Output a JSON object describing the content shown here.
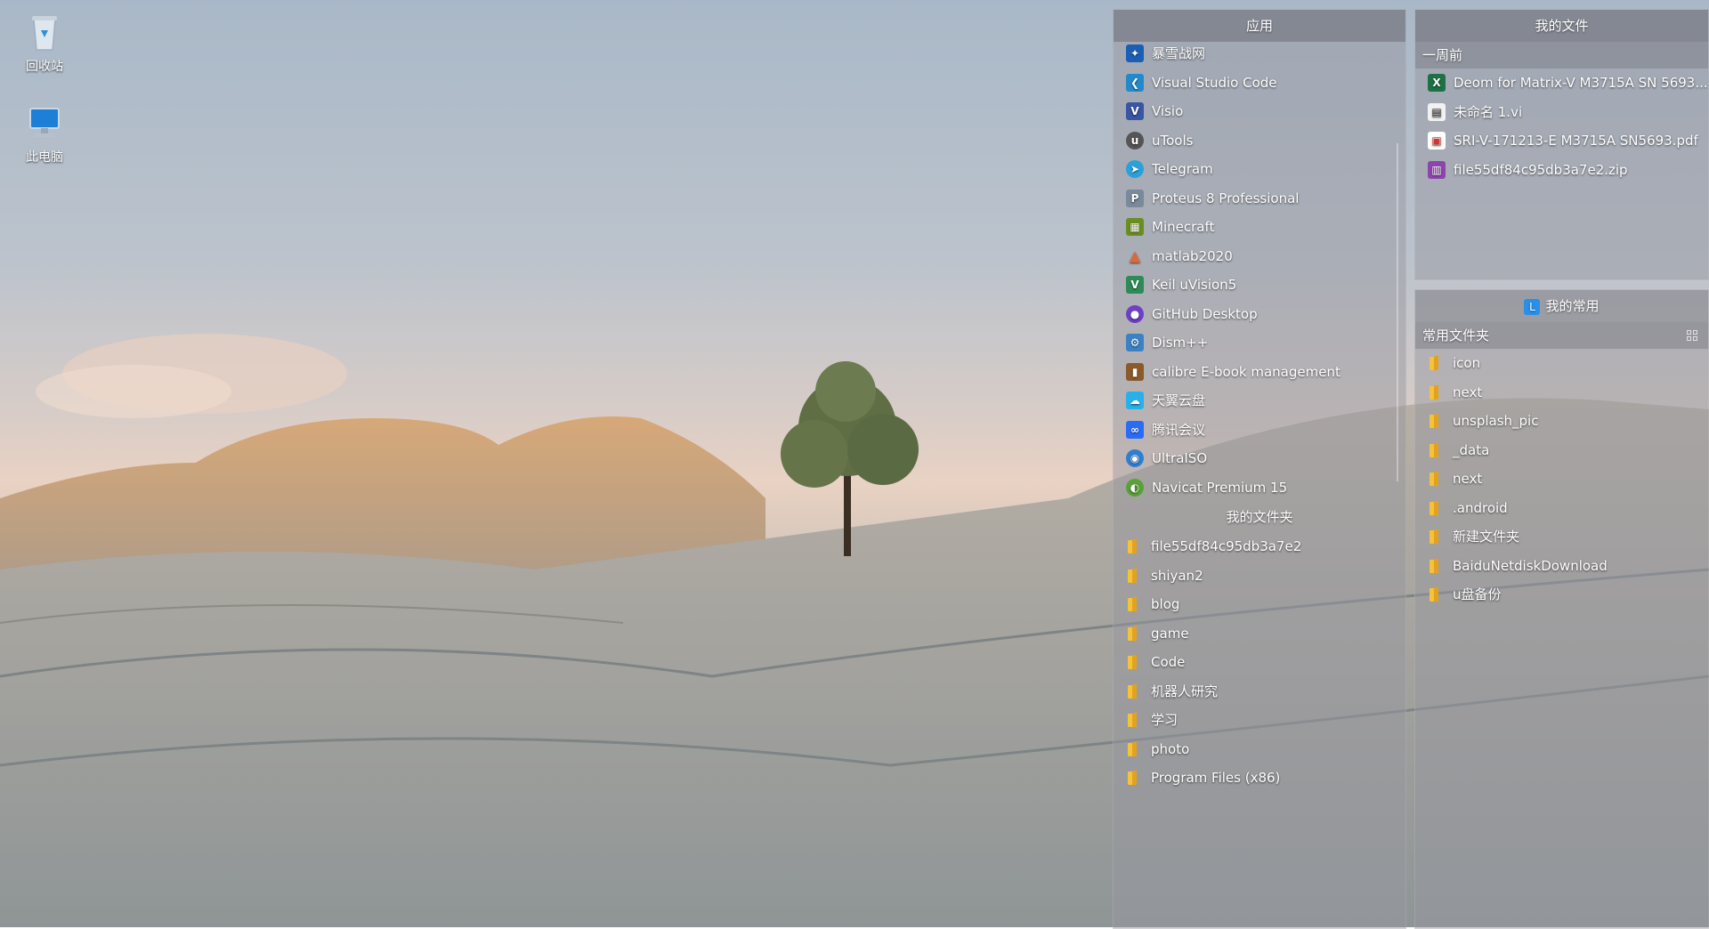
{
  "desktop": {
    "icons": [
      {
        "label": "回收站",
        "icon": "recycle-bin-icon"
      },
      {
        "label": "此电脑",
        "icon": "this-pc-icon"
      }
    ]
  },
  "apps_panel": {
    "title": "应用",
    "apps": [
      {
        "label": "暴雪战网",
        "icon": "battlenet-icon",
        "color": "#1a5fb4"
      },
      {
        "label": "Visual Studio Code",
        "icon": "vscode-icon",
        "color": "#2489ca"
      },
      {
        "label": "Visio",
        "icon": "visio-icon",
        "color": "#3955a3"
      },
      {
        "label": "uTools",
        "icon": "utools-icon",
        "color": "#555555"
      },
      {
        "label": "Telegram",
        "icon": "telegram-icon",
        "color": "#2aa1da"
      },
      {
        "label": "Proteus 8 Professional",
        "icon": "proteus-icon",
        "color": "#7a8a9a"
      },
      {
        "label": "Minecraft",
        "icon": "minecraft-icon",
        "color": "#6b8e23"
      },
      {
        "label": "matlab2020",
        "icon": "matlab-icon",
        "color": "#e16737"
      },
      {
        "label": "Keil uVision5",
        "icon": "keil-icon",
        "color": "#2e8b57"
      },
      {
        "label": "GitHub Desktop",
        "icon": "github-desktop-icon",
        "color": "#6e40c9"
      },
      {
        "label": "Dism++",
        "icon": "dism-icon",
        "color": "#3b82c4"
      },
      {
        "label": "calibre E-book management",
        "icon": "calibre-icon",
        "color": "#8b5a2b"
      },
      {
        "label": "天翼云盘",
        "icon": "tianyi-cloud-icon",
        "color": "#2ab0e8"
      },
      {
        "label": "腾讯会议",
        "icon": "tencent-meeting-icon",
        "color": "#2a6cf6"
      },
      {
        "label": "UltraISO",
        "icon": "ultraiso-icon",
        "color": "#2f7fd1"
      },
      {
        "label": "Navicat Premium 15",
        "icon": "navicat-icon",
        "color": "#5aa13a"
      }
    ],
    "folders_title": "我的文件夹",
    "folders": [
      "file55df84c95db3a7e2",
      "shiyan2",
      "blog",
      "game",
      "Code",
      "机器人研究",
      "学习",
      "photo",
      "Program Files (x86)"
    ]
  },
  "files_panel": {
    "title": "我的文件",
    "group": "一周前",
    "files": [
      {
        "label": "Deom for Matrix-V M3715A SN 5693...",
        "icon": "excel-file-icon",
        "color": "#1e7145"
      },
      {
        "label": "未命名 1.vi",
        "icon": "labview-file-icon",
        "color": "#f2f2f2"
      },
      {
        "label": "SRI-V-171213-E  M3715A  SN5693.pdf",
        "icon": "pdf-file-icon",
        "color": "#d9342b"
      },
      {
        "label": "file55df84c95db3a7e2.zip",
        "icon": "zip-file-icon",
        "color": "#8e44ad"
      }
    ]
  },
  "favorites_panel": {
    "title": "我的常用",
    "badge": "L",
    "group": "常用文件夹",
    "folders": [
      "icon",
      "next",
      "unsplash_pic",
      "_data",
      "next",
      ".android",
      "新建文件夹",
      "BaiduNetdiskDownload",
      "u盘备份"
    ]
  }
}
